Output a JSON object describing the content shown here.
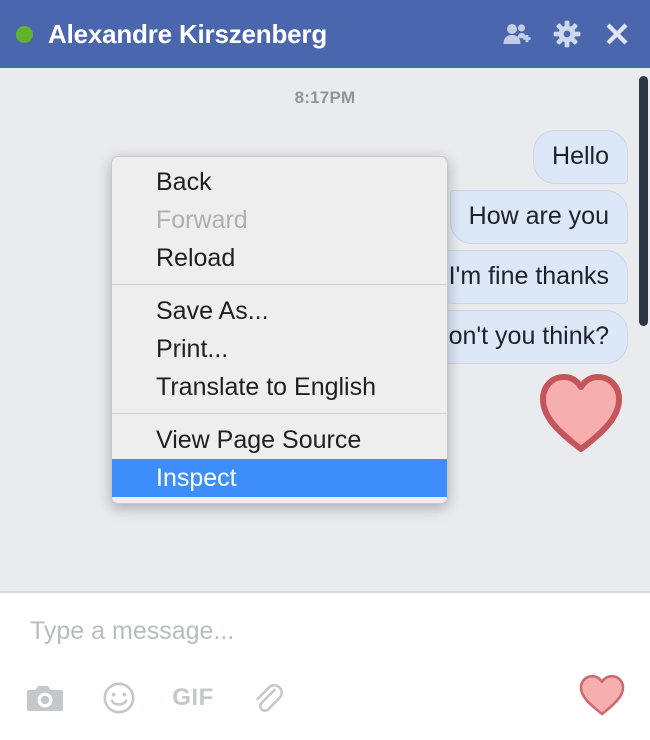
{
  "header": {
    "contact_name": "Alexandre Kirszenberg",
    "status": "online",
    "status_color": "#63b22e",
    "background_color": "#4a67ad",
    "actions": [
      {
        "name": "add-person-icon",
        "label": "Add People to Conversation"
      },
      {
        "name": "gear-icon",
        "label": "Conversation Settings"
      },
      {
        "name": "close-icon",
        "label": "Close Chat"
      }
    ]
  },
  "chat": {
    "timestamp": "8:17PM",
    "background_color": "#e9ebee",
    "bubble_color": "#dce7f7",
    "messages": [
      {
        "text": "Hello",
        "side": "outgoing",
        "shape": "r-first"
      },
      {
        "text": "How are you",
        "side": "outgoing",
        "shape": "r-mid"
      },
      {
        "text": "I'm fine thanks",
        "side": "outgoing",
        "shape": "r-mid"
      },
      {
        "text": "It's nice here, don't you think?",
        "side": "outgoing",
        "shape": "r-last"
      }
    ],
    "reaction": {
      "name": "heart-emoji",
      "symbol": "heart",
      "color": "#f4a8a8"
    }
  },
  "context_menu": {
    "highlight_color": "#3d8dfa",
    "items": [
      {
        "label": "Back",
        "state": "enabled"
      },
      {
        "label": "Forward",
        "state": "disabled"
      },
      {
        "label": "Reload",
        "state": "enabled"
      },
      {
        "separator": true
      },
      {
        "label": "Save As...",
        "state": "enabled"
      },
      {
        "label": "Print...",
        "state": "enabled"
      },
      {
        "label": "Translate to English",
        "state": "enabled"
      },
      {
        "separator": true
      },
      {
        "label": "View Page Source",
        "state": "enabled"
      },
      {
        "label": "Inspect",
        "state": "selected"
      }
    ]
  },
  "composer": {
    "placeholder": "Type a message...",
    "value": "",
    "tools": [
      {
        "name": "camera-icon",
        "label": "Send Photo"
      },
      {
        "name": "smiley-icon",
        "label": "Choose Sticker"
      },
      {
        "name": "gif-icon",
        "label": "GIF"
      },
      {
        "name": "paperclip-icon",
        "label": "Attach File"
      }
    ],
    "like_button": {
      "name": "heart-icon",
      "label": "Send Heart",
      "color": "#f4a8a8"
    }
  }
}
